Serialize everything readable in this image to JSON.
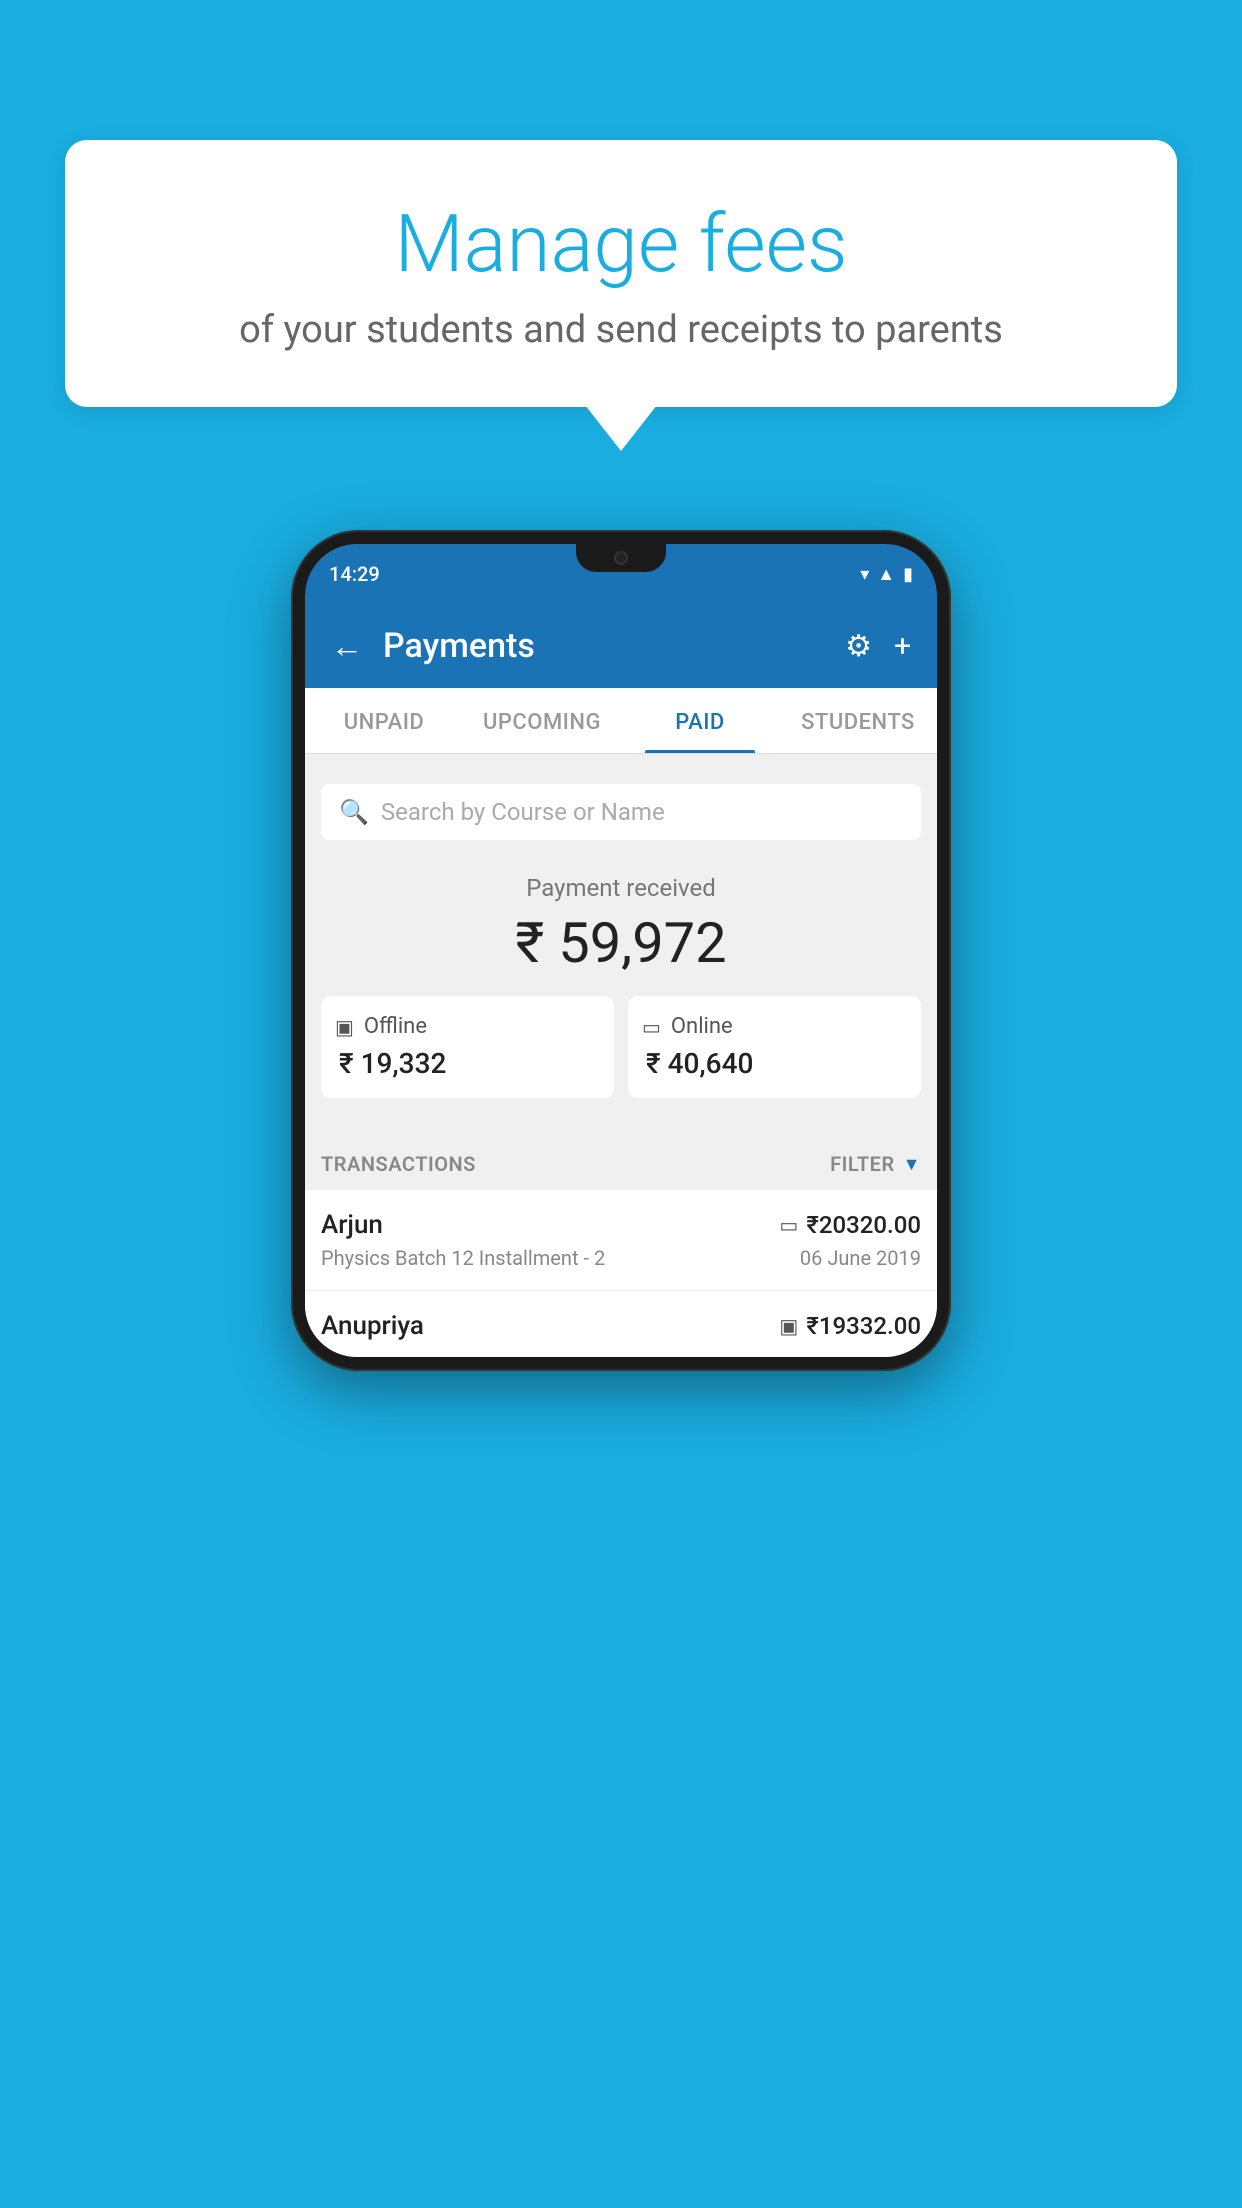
{
  "background_color": "#1AADE0",
  "speech_bubble": {
    "title": "Manage fees",
    "subtitle": "of your students and send receipts to parents"
  },
  "phone": {
    "status_bar": {
      "time": "14:29",
      "icons": [
        "wifi",
        "signal",
        "battery"
      ]
    },
    "header": {
      "title": "Payments",
      "back_label": "←",
      "settings_icon": "⚙",
      "add_icon": "+"
    },
    "tabs": [
      {
        "label": "UNPAID",
        "active": false
      },
      {
        "label": "UPCOMING",
        "active": false
      },
      {
        "label": "PAID",
        "active": true
      },
      {
        "label": "STUDENTS",
        "active": false
      }
    ],
    "search": {
      "placeholder": "Search by Course or Name"
    },
    "payment_summary": {
      "label": "Payment received",
      "amount": "₹ 59,972",
      "offline_label": "Offline",
      "offline_amount": "₹ 19,332",
      "online_label": "Online",
      "online_amount": "₹ 40,640"
    },
    "transactions_section": {
      "label": "TRANSACTIONS",
      "filter_label": "FILTER"
    },
    "transactions": [
      {
        "name": "Arjun",
        "course": "Physics Batch 12 Installment - 2",
        "amount": "₹20320.00",
        "date": "06 June 2019",
        "payment_type": "card"
      },
      {
        "name": "Anupriya",
        "course": "",
        "amount": "₹19332.00",
        "date": "",
        "payment_type": "cash"
      }
    ]
  }
}
